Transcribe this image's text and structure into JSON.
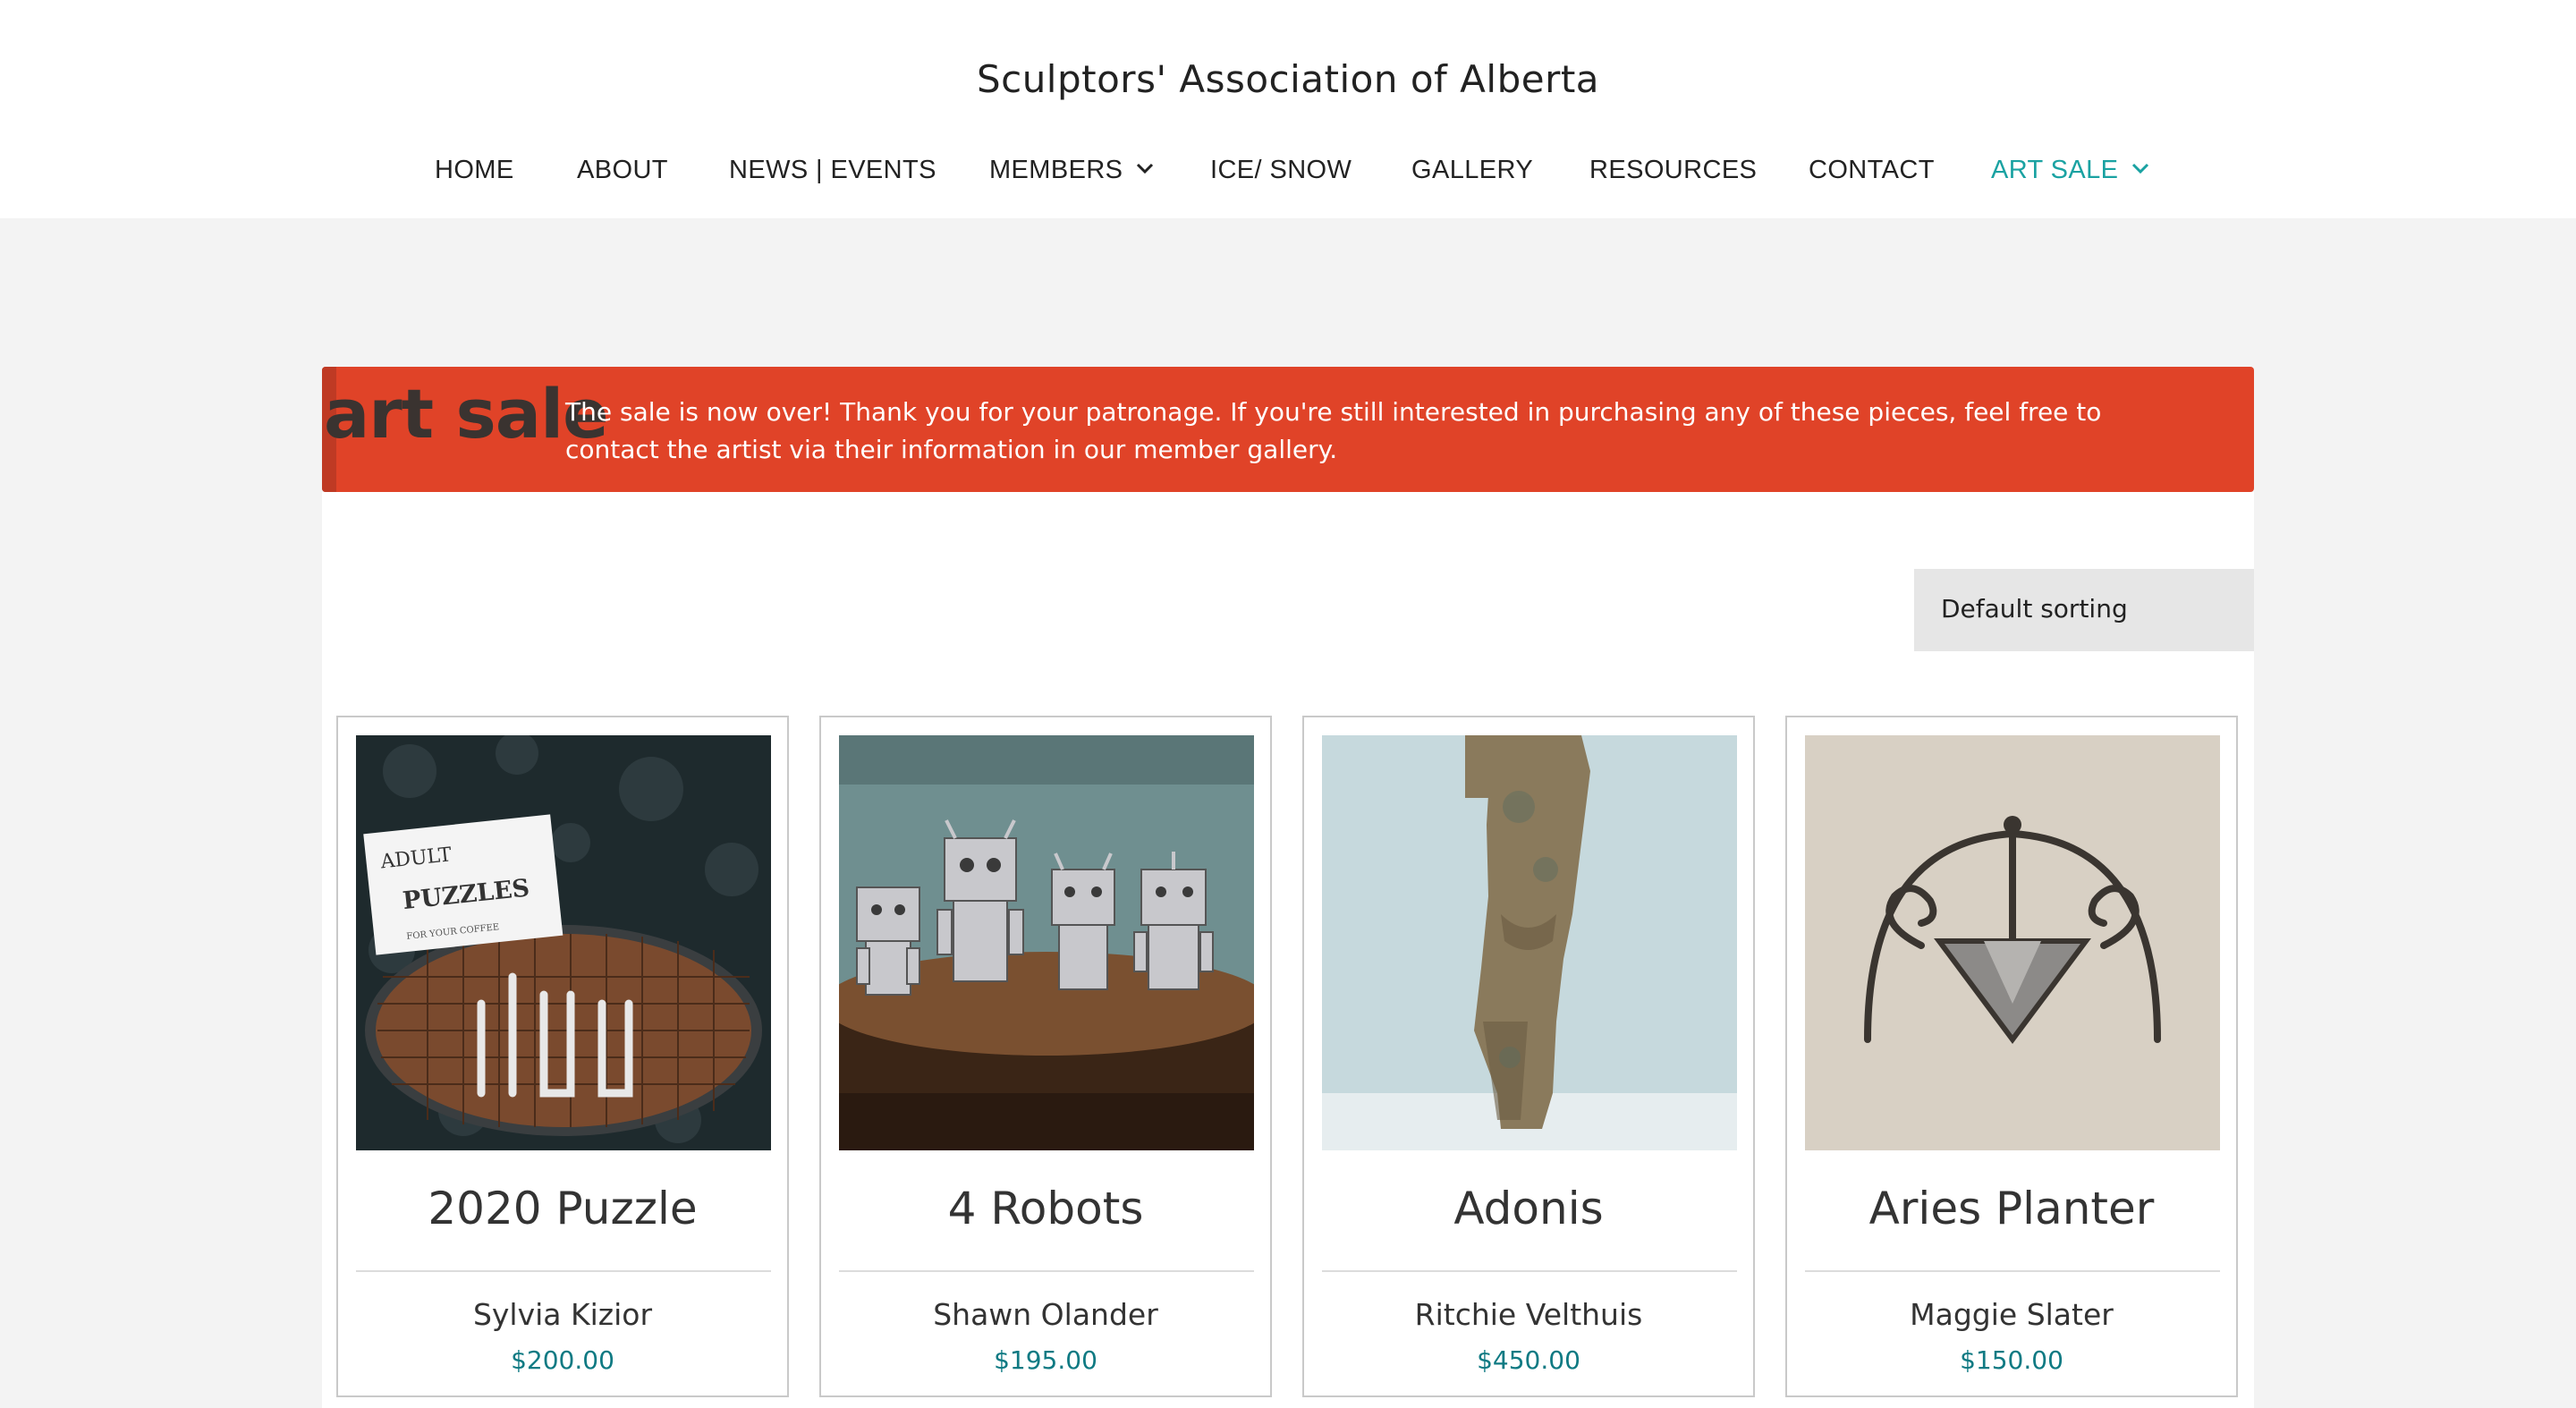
{
  "site": {
    "title": "Sculptors' Association of Alberta"
  },
  "nav": {
    "items": [
      {
        "label": "HOME"
      },
      {
        "label": "ABOUT"
      },
      {
        "label": "NEWS | EVENTS"
      },
      {
        "label": "MEMBERS"
      },
      {
        "label": "ICE/ SNOW"
      },
      {
        "label": "GALLERY"
      },
      {
        "label": "RESOURCES"
      },
      {
        "label": "CONTACT"
      },
      {
        "label": "ART SALE"
      }
    ],
    "active": "ART SALE"
  },
  "banner": {
    "title": "art sale",
    "message": "The sale is now over! Thank you for your patronage. If you're still interested in purchasing any of these pieces, feel free to contact the artist via their information in our member gallery.",
    "color": "#e04328"
  },
  "sorting": {
    "selected": "Default sorting"
  },
  "products": [
    {
      "title": "2020 Puzzle",
      "artist": "Sylvia Kizior",
      "price": "$200.00",
      "image_text": [
        "ADULT",
        "PUZZLES",
        "FOR YOUR COFFEE"
      ]
    },
    {
      "title": "4 Robots",
      "artist": "Shawn Olander",
      "price": "$195.00"
    },
    {
      "title": "Adonis",
      "artist": "Ritchie Velthuis",
      "price": "$450.00"
    },
    {
      "title": "Aries Planter",
      "artist": "Maggie Slater",
      "price": "$150.00"
    }
  ],
  "colors": {
    "accent": "#1aa2a2",
    "price": "#0f7a83",
    "banner": "#e04328"
  }
}
